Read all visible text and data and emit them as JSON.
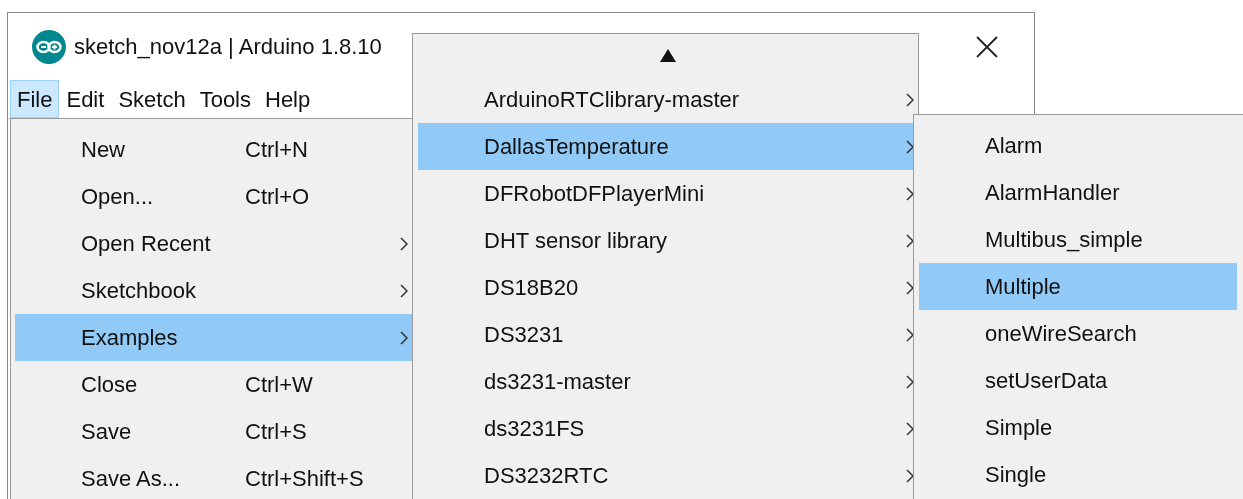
{
  "window": {
    "title": "sketch_nov12a | Arduino 1.8.10"
  },
  "menubar": [
    {
      "label": "File",
      "selected": true
    },
    {
      "label": "Edit",
      "selected": false
    },
    {
      "label": "Sketch",
      "selected": false
    },
    {
      "label": "Tools",
      "selected": false
    },
    {
      "label": "Help",
      "selected": false
    }
  ],
  "file_menu": [
    {
      "label": "New",
      "shortcut": "Ctrl+N",
      "submenu": false,
      "selected": false
    },
    {
      "label": "Open...",
      "shortcut": "Ctrl+O",
      "submenu": false,
      "selected": false
    },
    {
      "label": "Open Recent",
      "submenu": true,
      "selected": false
    },
    {
      "label": "Sketchbook",
      "submenu": true,
      "selected": false
    },
    {
      "label": "Examples",
      "submenu": true,
      "selected": true
    },
    {
      "label": "Close",
      "shortcut": "Ctrl+W",
      "submenu": false,
      "selected": false
    },
    {
      "label": "Save",
      "shortcut": "Ctrl+S",
      "submenu": false,
      "selected": false
    },
    {
      "label": "Save As...",
      "shortcut": "Ctrl+Shift+S",
      "submenu": false,
      "selected": false
    }
  ],
  "examples_menu": [
    {
      "label": "ArduinoRTClibrary-master",
      "submenu": true,
      "selected": false
    },
    {
      "label": "DallasTemperature",
      "submenu": true,
      "selected": true
    },
    {
      "label": "DFRobotDFPlayerMini",
      "submenu": true,
      "selected": false
    },
    {
      "label": "DHT sensor library",
      "submenu": true,
      "selected": false
    },
    {
      "label": "DS18B20",
      "submenu": true,
      "selected": false
    },
    {
      "label": "DS3231",
      "submenu": true,
      "selected": false
    },
    {
      "label": "ds3231-master",
      "submenu": true,
      "selected": false
    },
    {
      "label": "ds3231FS",
      "submenu": true,
      "selected": false
    },
    {
      "label": "DS3232RTC",
      "submenu": true,
      "selected": false
    }
  ],
  "dallas_menu": [
    {
      "label": "Alarm",
      "selected": false
    },
    {
      "label": "AlarmHandler",
      "selected": false
    },
    {
      "label": "Multibus_simple",
      "selected": false
    },
    {
      "label": "Multiple",
      "selected": true
    },
    {
      "label": "oneWireSearch",
      "selected": false
    },
    {
      "label": "setUserData",
      "selected": false
    },
    {
      "label": "Simple",
      "selected": false
    },
    {
      "label": "Single",
      "selected": false
    }
  ]
}
